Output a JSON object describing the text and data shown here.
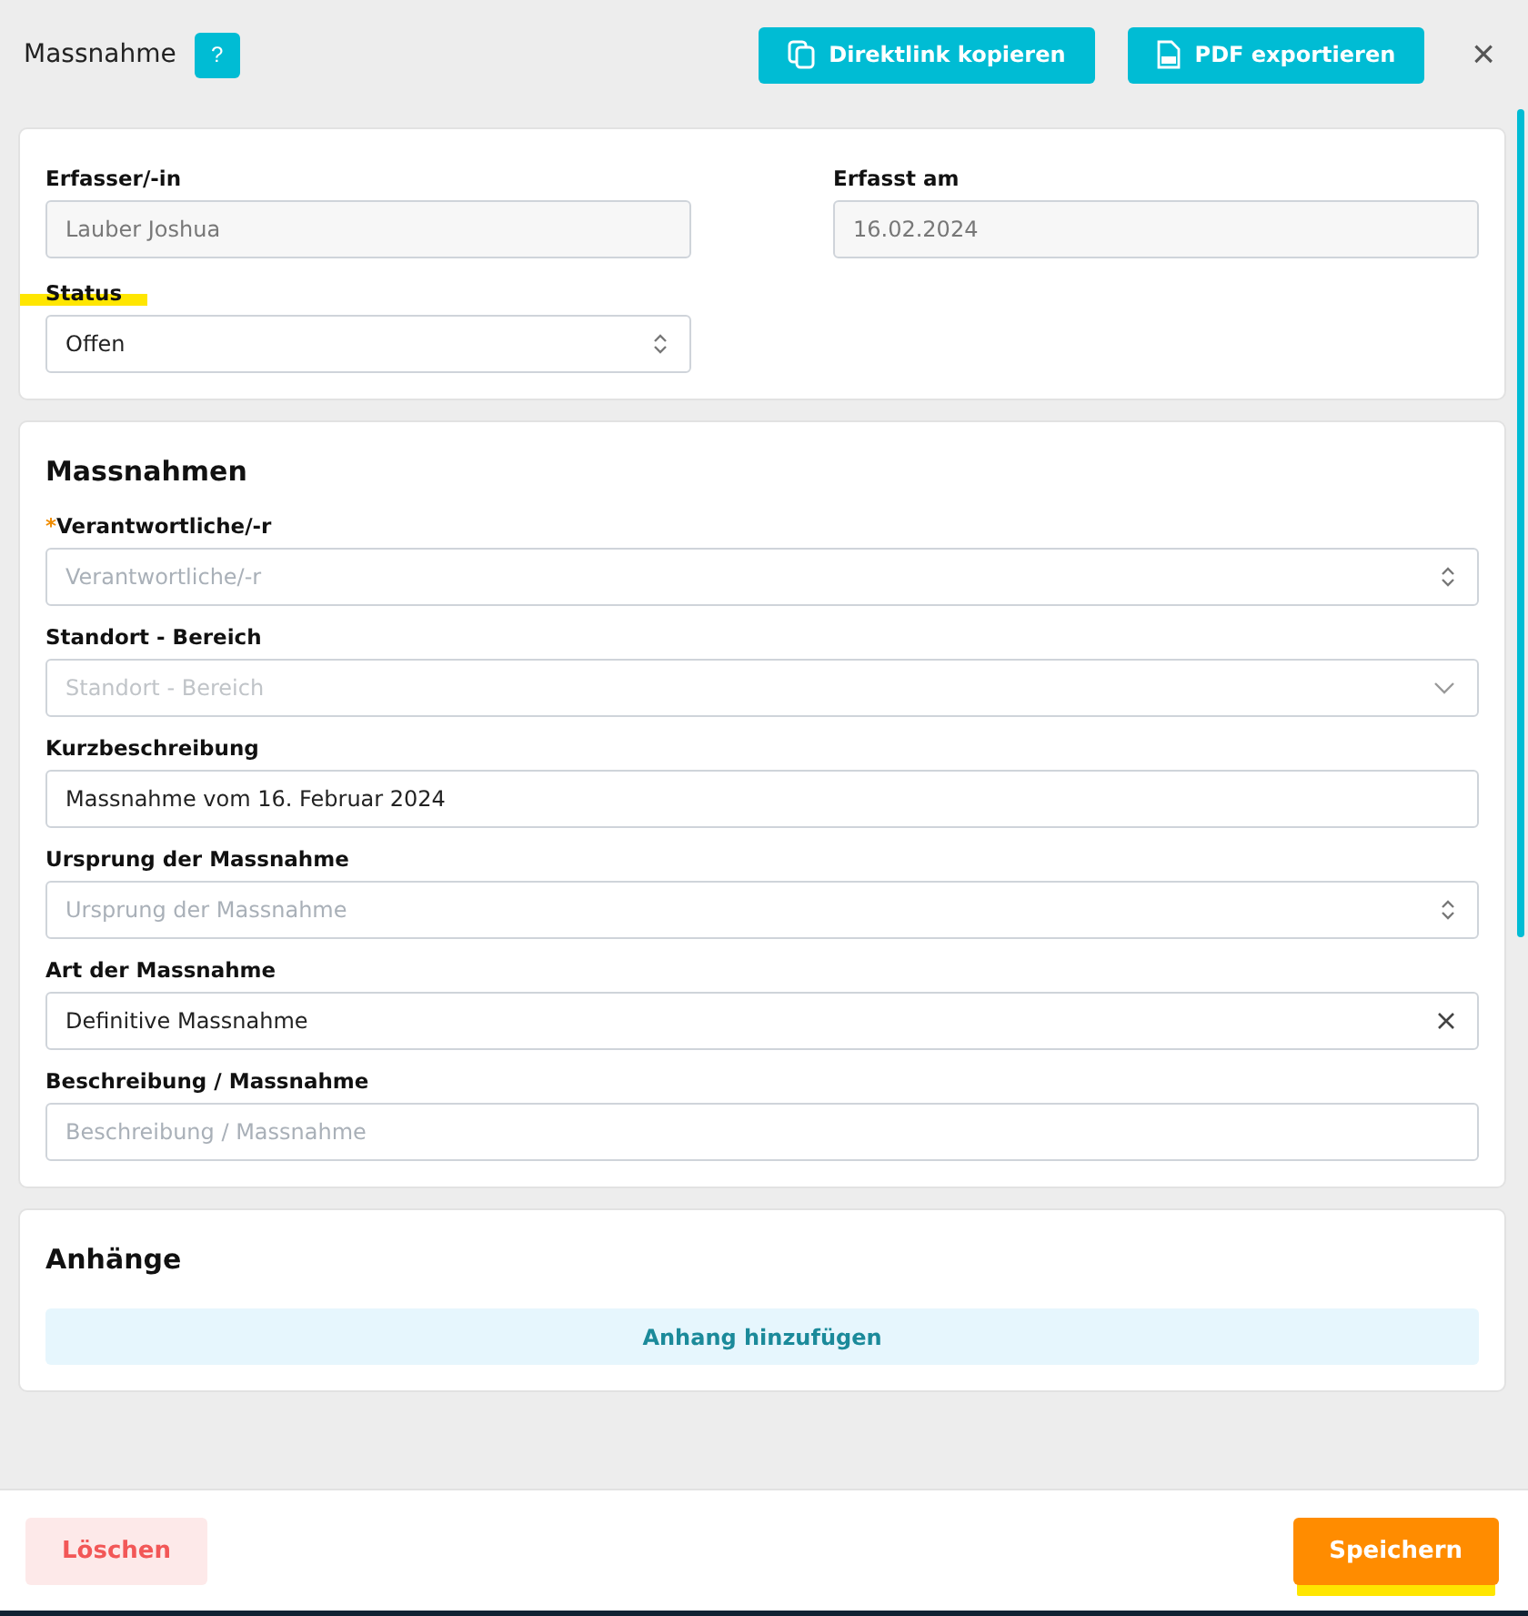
{
  "header": {
    "title": "Massnahme",
    "help": "?",
    "buttons": [
      {
        "label": "Direktlink kopieren",
        "kind": "copy"
      },
      {
        "label": "PDF exportieren",
        "kind": "pdf"
      }
    ],
    "close": "×"
  },
  "general": {
    "fields": [
      {
        "label": "Erfasser/-in",
        "kind": "readonly",
        "value": "Lauber Joshua",
        "highlighted": false
      },
      {
        "label": "Erfasst am",
        "kind": "readonly",
        "value": "16.02.2024",
        "highlighted": false
      },
      {
        "label": "Status",
        "kind": "updown",
        "value": "Offen",
        "highlighted": true
      }
    ]
  },
  "massnahmen": {
    "title": "Massnahmen",
    "fields": [
      {
        "label": "Verantwortliche/-r",
        "kind": "updown",
        "placeholder": "Verantwortliche/-r",
        "required_mark": "*",
        "highlighted": false
      },
      {
        "label": "Standort - Bereich",
        "kind": "dropdown",
        "placeholder": "Standort - Bereich",
        "highlighted": false
      },
      {
        "label": "Kurzbeschreibung",
        "kind": "text",
        "value": "Massnahme vom 16. Februar 2024",
        "highlighted": false
      },
      {
        "label": "Ursprung der Massnahme",
        "kind": "updown",
        "placeholder": "Ursprung der Massnahme",
        "highlighted": false
      },
      {
        "label": "Art der Massnahme",
        "kind": "clear",
        "value": "Definitive Massnahme",
        "highlighted": false
      },
      {
        "label": "Beschreibung / Massnahme",
        "kind": "text",
        "placeholder": "Beschreibung / Massnahme",
        "highlighted": false
      }
    ]
  },
  "attachments": {
    "title": "Anhänge",
    "add_button": "Anhang hinzufügen"
  },
  "footer": {
    "delete": "Löschen",
    "save": {
      "label": "Speichern",
      "highlighted": true
    }
  }
}
